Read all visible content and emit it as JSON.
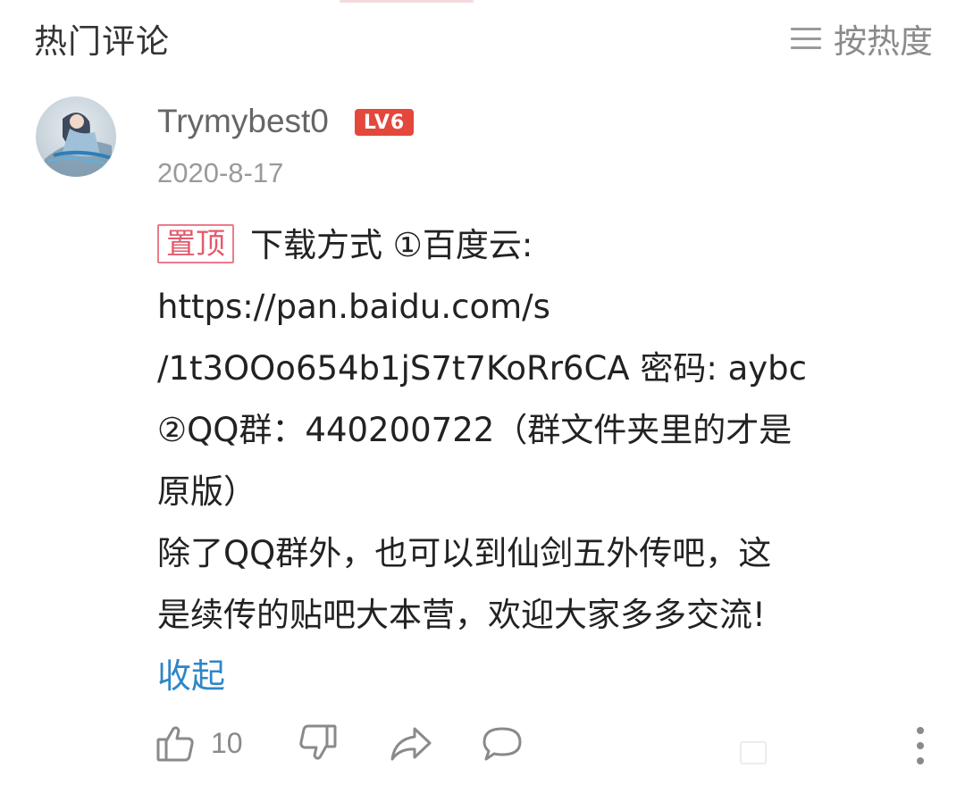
{
  "header": {
    "title": "热门评论",
    "sort_label": "按热度",
    "sort_icon": "menu-lines-icon"
  },
  "comment": {
    "username": "Trymybest0",
    "level": "LV6",
    "date": "2020-8-17",
    "pin_tag": "置顶",
    "content_lines": [
      "下载方式 ①百度云:",
      "https://pan.baidu.com/s",
      "/1t3OOo654b1jS7t7KoRr6CA 密码: aybc",
      "②QQ群：440200722（群文件夹里的才是",
      "原版）",
      "除了QQ群外，也可以到仙剑五外传吧，这",
      "是续传的贴吧大本营，欢迎大家多多交流!"
    ],
    "collapse_label": "收起"
  },
  "actions": {
    "like_count": "10",
    "icons": [
      "thumbs-up-icon",
      "thumbs-down-icon",
      "share-icon",
      "comment-icon",
      "more-icon"
    ]
  },
  "colors": {
    "level_badge": "#e4473b",
    "pin_tag": "#e45a6c",
    "link": "#2f86c7",
    "muted": "#9a9a9a"
  }
}
